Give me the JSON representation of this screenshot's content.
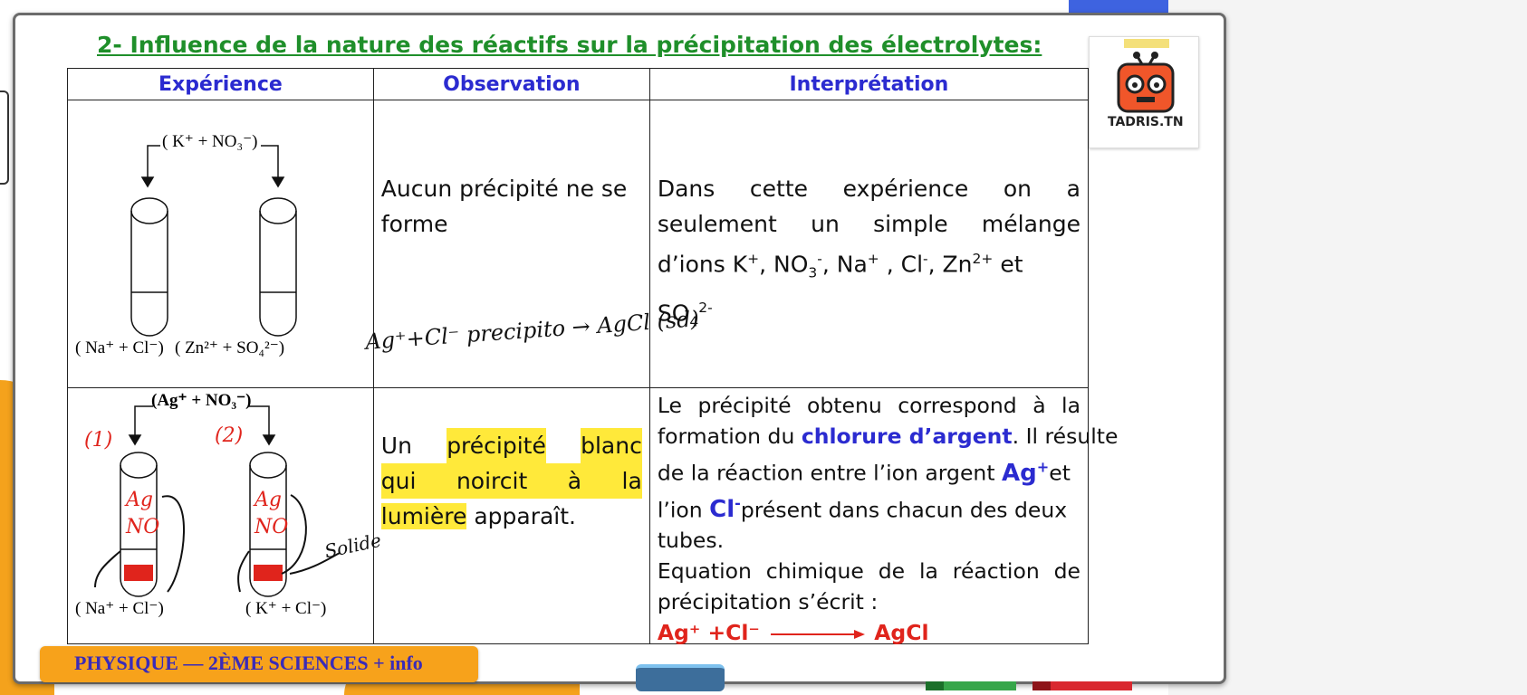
{
  "title": "2- Influence de la nature des réactifs sur la précipitation des électrolytes:",
  "headers": {
    "experience": "Expérience",
    "observation": "Observation",
    "interpretation": "Interprétation"
  },
  "row1": {
    "diagram_top_label": "( K⁺ + NO₃⁻)",
    "diagram_bottom_left": "( Na⁺ + Cl⁻)",
    "diagram_bottom_right": "( Zn²⁺ + SO₄²⁻)",
    "observation_line1": "Aucun précipité ne se",
    "observation_line2": "forme",
    "interpretation_line1": "Dans cette expérience on a",
    "interpretation_line2": "seulement un simple mélange",
    "interpretation_line3a": "d’ions K",
    "interpretation_line3b": ", NO",
    "interpretation_line3c": ", Na",
    "interpretation_line3d": " , Cl",
    "interpretation_line3e": ", Zn",
    "interpretation_line3f": " et",
    "interpretation_line4": "SO",
    "sup_plus": "+",
    "sup_minus": "-",
    "sup_2plus": "2+",
    "sup_2minus": "2-",
    "sub_3": "3",
    "sub_4": "4",
    "handwritten_note": "Ag⁺+Cl⁻ precipito → AgCl (sd)"
  },
  "row2": {
    "diagram_top_label": "(Ag⁺ + NO₃⁻)",
    "tube1_label": "(1)",
    "tube2_label": "(2)",
    "diagram_bottom_left": "( Na⁺ + Cl⁻)",
    "diagram_bottom_right": "( K⁺ + Cl⁻)",
    "handwritten_solide": "Solide",
    "observation_w1": "Un",
    "observation_w2": "précipité",
    "observation_w3": "blanc",
    "observation_w4": "qui",
    "observation_w5": "noircit",
    "observation_w6": "à",
    "observation_w7": "la",
    "observation_w8": "lumière",
    "observation_w9": "apparaît.",
    "interp_line1": "Le précipité obtenu correspond à la",
    "interp_line2a": "formation du ",
    "interp_line2b": "chlorure d’argent",
    "interp_line2c": ". Il résulte",
    "interp_line3a": "de la réaction entre l’ion argent ",
    "interp_line3b": "Ag",
    "interp_line3c": "et",
    "interp_line4a": "l’ion ",
    "interp_line4b": "Cl",
    "interp_line4c": "présent dans chacun des deux",
    "interp_line5": "tubes.",
    "interp_line6": "Equation chimique de la réaction de",
    "interp_line7": "précipitation s’écrit :",
    "eq_left": "Ag⁺ +Cl⁻",
    "eq_right": "AgCl"
  },
  "banner": "PHYSIQUE — 2ÈME SCIENCES + info",
  "logo_text": "TADRIS.TN",
  "colors": {
    "title_green": "#1f8f2a",
    "header_blue": "#2b2bd0",
    "highlight_yellow": "#ffe93a",
    "equation_red": "#e0241c",
    "banner_orange": "#f7a21b"
  }
}
